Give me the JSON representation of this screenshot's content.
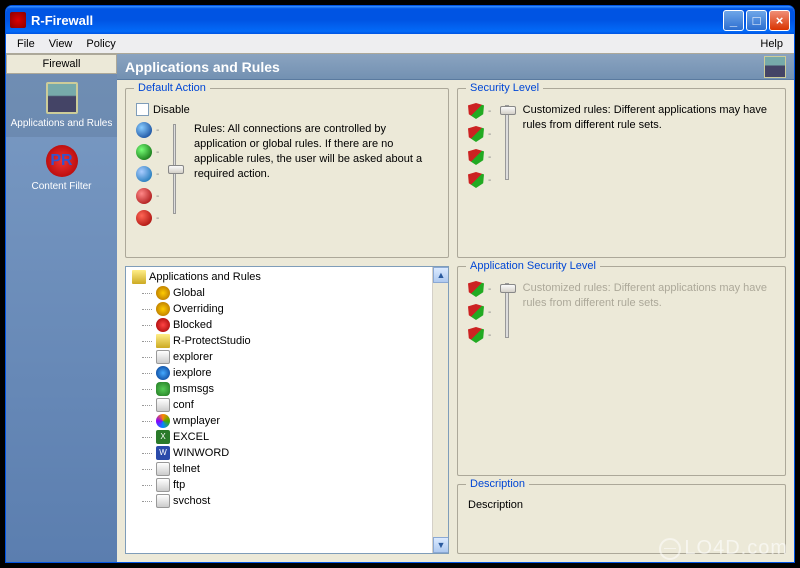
{
  "window": {
    "title": "R-Firewall"
  },
  "menu": {
    "file": "File",
    "view": "View",
    "policy": "Policy",
    "help": "Help"
  },
  "sidebar": {
    "header": "Firewall",
    "items": [
      {
        "label": "Applications and Rules"
      },
      {
        "label": "Content Filter"
      }
    ]
  },
  "page": {
    "title": "Applications and Rules"
  },
  "default_action": {
    "legend": "Default Action",
    "disable_label": "Disable",
    "rule_desc": "Rules: All connections are controlled by application or global rules. If there are no applicable rules, the user will be asked about a required action."
  },
  "security_level": {
    "legend": "Security Level",
    "desc": "Customized rules: Different applications may have rules from different rule sets."
  },
  "app_security_level": {
    "legend": "Application Security Level",
    "desc": "Customized rules: Different applications may have rules from different rule sets."
  },
  "description_box": {
    "legend": "Description",
    "text": "Description"
  },
  "tree": {
    "root": "Applications and Rules",
    "items": [
      "Global",
      "Overriding",
      "Blocked",
      "R-ProtectStudio",
      "explorer",
      "iexplore",
      "msmsgs",
      "conf",
      "wmplayer",
      "EXCEL",
      "WINWORD",
      "telnet",
      "ftp",
      "svchost"
    ]
  },
  "watermark": "LO4D.com"
}
